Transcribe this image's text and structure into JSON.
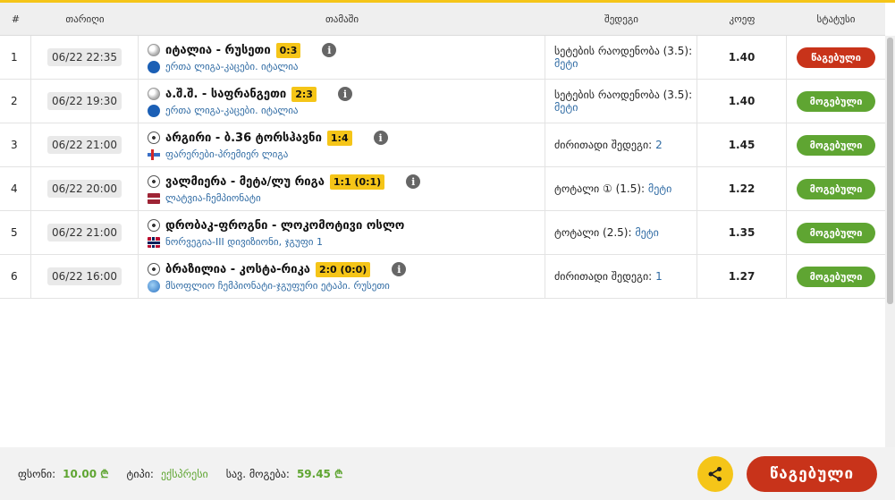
{
  "header": {
    "num": "#",
    "date": "თარიღი",
    "match": "თამაში",
    "result": "შედეგი",
    "odds": "კოეფ",
    "status": "სტატუსი"
  },
  "rows": [
    {
      "num": "1",
      "date": "06/22 22:35",
      "title": "იტალია - რუსეთი",
      "score": "0:3",
      "league": "ერთა ლიგა",
      "league_sep": " - ",
      "league_cat": "კაცები. იტალია",
      "result_label": "სეტების რაოდენობა (3.5):",
      "result_value": "მეტი",
      "odds": "1.40",
      "status": "წაგებული"
    },
    {
      "num": "2",
      "date": "06/22 19:30",
      "title": "ა.შ.შ. - საფრანგეთი",
      "score": "2:3",
      "league": "ერთა ლიგა",
      "league_sep": " - ",
      "league_cat": "კაცები. იტალია",
      "result_label": "სეტების რაოდენობა (3.5):",
      "result_value": "მეტი",
      "odds": "1.40",
      "status": "მოგებული"
    },
    {
      "num": "3",
      "date": "06/22 21:00",
      "title": "არგირი - ბ.36 ტორსჰავნი",
      "score": "1:4",
      "league": "ფარერები",
      "league_sep": " - ",
      "league_cat": "პრემიერ ლიგა",
      "result_label": "ძირითადი შედეგი:",
      "result_value": "2",
      "odds": "1.45",
      "status": "მოგებული"
    },
    {
      "num": "4",
      "date": "06/22 20:00",
      "title": "ვალმიერა - მეტა/ლუ რიგა",
      "score": "1:1 (0:1)",
      "league": "ლატვია",
      "league_sep": " - ",
      "league_cat": "ჩემპიონატი",
      "result_label": "ტოტალი ① (1.5):",
      "result_value": "მეტი",
      "odds": "1.22",
      "status": "მოგებული"
    },
    {
      "num": "5",
      "date": "06/22 21:00",
      "title": "დრობაკ-ფროგნი - ლოკომოტივი ოსლო",
      "score": "",
      "league": "ნორვეგია",
      "league_sep": " - ",
      "league_cat": "III დივიზიონი, ჯგუფი 1",
      "result_label": "ტოტალი (2.5):",
      "result_value": "მეტი",
      "odds": "1.35",
      "status": "მოგებული"
    },
    {
      "num": "6",
      "date": "06/22 16:00",
      "title": "ბრაზილია - კოსტა-რიკა",
      "score": "2:0 (0:0)",
      "league": "მსოფლიო ჩემპიონატი",
      "league_sep": " - ",
      "league_cat": "ჯგუფური ეტაპი. რუსეთი",
      "result_label": "ძირითადი შედეგი:",
      "result_value": "1",
      "odds": "1.27",
      "status": "მოგებული"
    }
  ],
  "footer": {
    "stake_label": "ფსონი:",
    "stake_value": "10.00 ₾",
    "type_label": "ტიპი:",
    "type_value": "ექსპრესი",
    "win_label": "სავ. მოგება:",
    "win_value": "59.45 ₾",
    "status_button": "წაგებული"
  },
  "colors": {
    "accent": "#f5c518",
    "lost": "#c8331a",
    "won": "#5fa532",
    "link": "#2e6aa3"
  },
  "icons": {
    "info": "info-icon",
    "share": "share-icon"
  }
}
